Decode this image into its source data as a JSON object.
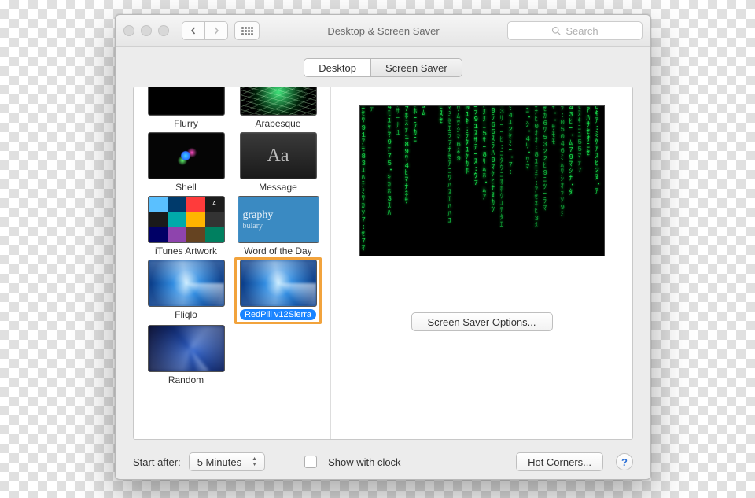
{
  "window": {
    "title": "Desktop & Screen Saver",
    "search_placeholder": "Search"
  },
  "tabs": {
    "desktop": "Desktop",
    "screensaver": "Screen Saver"
  },
  "savers": [
    {
      "id": "flurry",
      "label": "Flurry"
    },
    {
      "id": "arabesque",
      "label": "Arabesque"
    },
    {
      "id": "shell",
      "label": "Shell"
    },
    {
      "id": "message",
      "label": "Message"
    },
    {
      "id": "itunes",
      "label": "iTunes Artwork"
    },
    {
      "id": "word",
      "label": "Word of the Day"
    },
    {
      "id": "fliqlo",
      "label": "Fliqlo"
    },
    {
      "id": "redpill",
      "label": "RedPill v12Sierra",
      "selected": true
    },
    {
      "id": "random",
      "label": "Random"
    }
  ],
  "message_preview_glyph": "Aa",
  "word_preview": {
    "line1": "graphy",
    "line2": "bulary"
  },
  "options_button": "Screen Saver Options...",
  "bottom": {
    "start_after_label": "Start after:",
    "start_after_value": "5 Minutes",
    "show_clock_label": "Show with clock",
    "hot_corners_button": "Hot Corners...",
    "help_glyph": "?"
  }
}
